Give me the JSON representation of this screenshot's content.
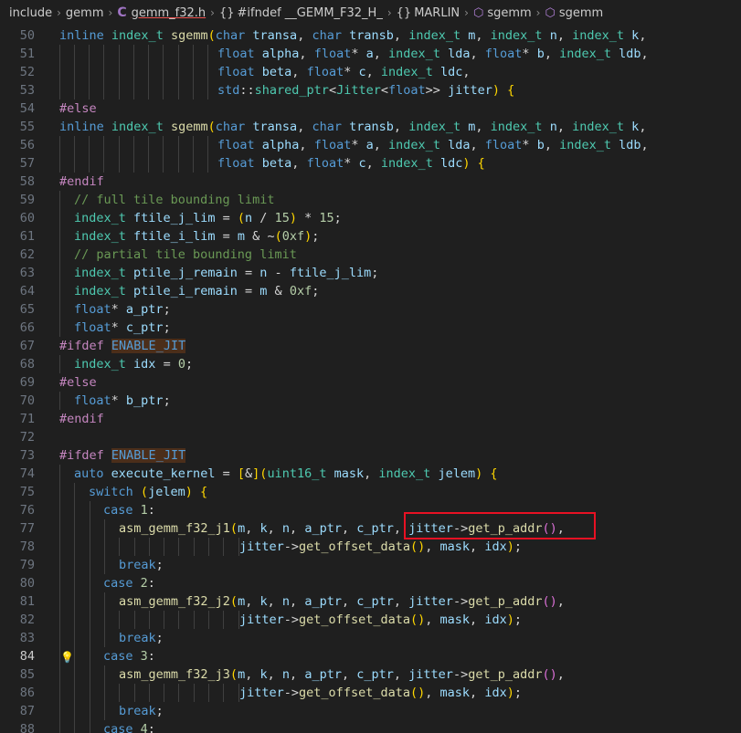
{
  "breadcrumb": {
    "items": [
      "include",
      "gemm",
      "gemm_f32.h",
      "#ifndef __GEMM_F32_H_",
      "MARLIN",
      "sgemm",
      "sgemm"
    ]
  },
  "editor": {
    "active_line": 84,
    "lines": [
      {
        "n": "50",
        "t": "inline index_t sgemm(char transa, char transb, index_t m, index_t n, index_t k,"
      },
      {
        "n": "51",
        "t": "float alpha, float* a, index_t lda, float* b, index_t ldb,"
      },
      {
        "n": "52",
        "t": "float beta, float* c, index_t ldc,"
      },
      {
        "n": "53",
        "t": "std::shared_ptr<Jitter<float>> jitter) {"
      },
      {
        "n": "54",
        "t": "#else"
      },
      {
        "n": "55",
        "t": "inline index_t sgemm(char transa, char transb, index_t m, index_t n, index_t k,"
      },
      {
        "n": "56",
        "t": "float alpha, float* a, index_t lda, float* b, index_t ldb,"
      },
      {
        "n": "57",
        "t": "float beta, float* c, index_t ldc) {"
      },
      {
        "n": "58",
        "t": "#endif"
      },
      {
        "n": "59",
        "t": "// full tile bounding limit"
      },
      {
        "n": "60",
        "t": "index_t ftile_j_lim = (n / 15) * 15;"
      },
      {
        "n": "61",
        "t": "index_t ftile_i_lim = m & ~(0xf);"
      },
      {
        "n": "62",
        "t": "// partial tile bounding limit"
      },
      {
        "n": "63",
        "t": "index_t ptile_j_remain = n - ftile_j_lim;"
      },
      {
        "n": "64",
        "t": "index_t ptile_i_remain = m & 0xf;"
      },
      {
        "n": "65",
        "t": "float* a_ptr;"
      },
      {
        "n": "66",
        "t": "float* c_ptr;"
      },
      {
        "n": "67",
        "t": "#ifdef ENABLE_JIT"
      },
      {
        "n": "68",
        "t": "index_t idx = 0;"
      },
      {
        "n": "69",
        "t": "#else"
      },
      {
        "n": "70",
        "t": "float* b_ptr;"
      },
      {
        "n": "71",
        "t": "#endif"
      },
      {
        "n": "72",
        "t": ""
      },
      {
        "n": "73",
        "t": "#ifdef ENABLE_JIT"
      },
      {
        "n": "74",
        "t": "auto execute_kernel = [&](uint16_t mask, index_t jelem) {"
      },
      {
        "n": "75",
        "t": "switch (jelem) {"
      },
      {
        "n": "76",
        "t": "case 1:"
      },
      {
        "n": "77",
        "t": "asm_gemm_f32_j1(m, k, n, a_ptr, c_ptr, jitter->get_p_addr(),"
      },
      {
        "n": "78",
        "t": "jitter->get_offset_data(), mask, idx);"
      },
      {
        "n": "79",
        "t": "break;"
      },
      {
        "n": "80",
        "t": "case 2:"
      },
      {
        "n": "81",
        "t": "asm_gemm_f32_j2(m, k, n, a_ptr, c_ptr, jitter->get_p_addr(),"
      },
      {
        "n": "82",
        "t": "jitter->get_offset_data(), mask, idx);"
      },
      {
        "n": "83",
        "t": "break;"
      },
      {
        "n": "84",
        "t": "case 3:"
      },
      {
        "n": "85",
        "t": "asm_gemm_f32_j3(m, k, n, a_ptr, c_ptr, jitter->get_p_addr(),"
      },
      {
        "n": "86",
        "t": "jitter->get_offset_data(), mask, idx);"
      },
      {
        "n": "87",
        "t": "break;"
      },
      {
        "n": "88",
        "t": "case 4:"
      }
    ]
  },
  "colors": {
    "keyword": "#569cd6",
    "type": "#4ec9b0",
    "function": "#dcdcaa",
    "identifier": "#9cdcfe",
    "preprocessor": "#c586c0",
    "comment": "#6a9955",
    "number": "#b5cea8",
    "highlight_box": "#e81123"
  }
}
